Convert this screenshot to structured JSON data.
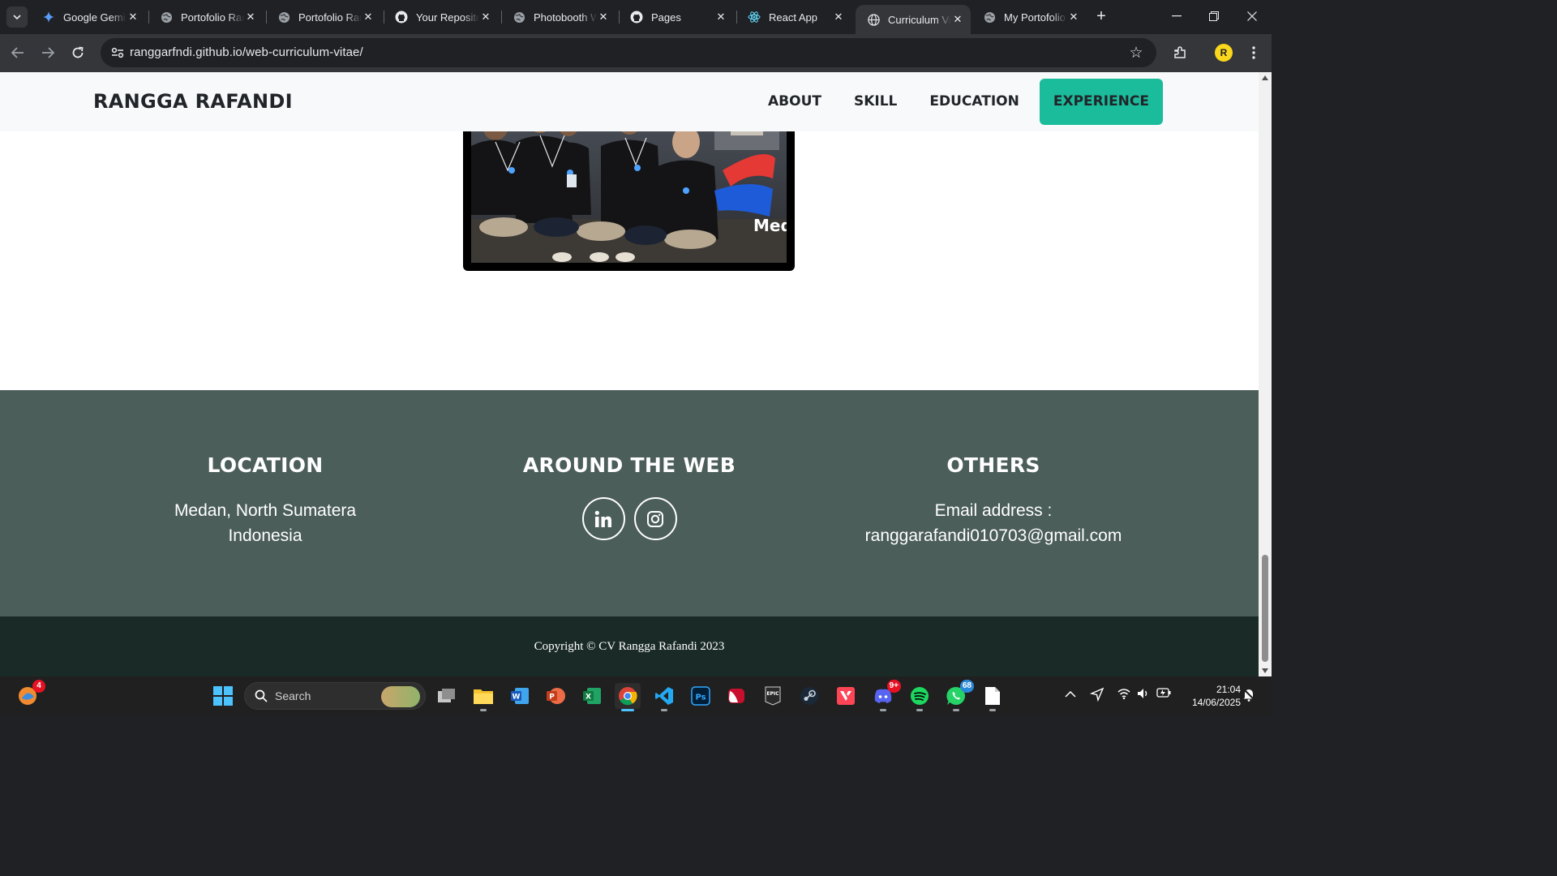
{
  "browser": {
    "tabs": [
      {
        "title": "Google Gemini",
        "icon": "gemini-icon"
      },
      {
        "title": "Portofolio Rangga",
        "icon": "globe-icon"
      },
      {
        "title": "Portofolio Rangga",
        "icon": "globe-icon"
      },
      {
        "title": "Your Repositories",
        "icon": "github-icon"
      },
      {
        "title": "Photobooth Web",
        "icon": "globe-icon"
      },
      {
        "title": "Pages",
        "icon": "github-icon"
      },
      {
        "title": "React App",
        "icon": "react-icon"
      },
      {
        "title": "Curriculum Vitae",
        "icon": "globe-icon",
        "active": true
      },
      {
        "title": "My Portofolio",
        "icon": "globe-icon"
      }
    ],
    "url": "ranggarfndi.github.io/web-curriculum-vitae/",
    "profile_initial": "R"
  },
  "site": {
    "brand": "RANGGA RAFANDI",
    "nav": [
      "ABOUT",
      "SKILL",
      "EDUCATION",
      "EXPERIENCE"
    ],
    "active_nav": "EXPERIENCE",
    "accent_color": "#1abc9c",
    "photo_overlay_text": "Med"
  },
  "footer": {
    "location": {
      "heading": "LOCATION",
      "line1": "Medan, North Sumatera",
      "line2": "Indonesia"
    },
    "web": {
      "heading": "AROUND THE WEB",
      "links": [
        "linkedin-icon",
        "instagram-icon"
      ]
    },
    "others": {
      "heading": "OTHERS",
      "line1": "Email address :",
      "line2": "ranggarafandi010703@gmail.com"
    },
    "copyright": "Copyright © CV Rangga Rafandi 2023",
    "bg_color": "#4b5e59",
    "copyright_bg": "#1a2b27"
  },
  "taskbar": {
    "search_label": "Search",
    "badges": {
      "browser_widget": "4",
      "discord": "9+",
      "whatsapp": "68"
    },
    "time": "21:04",
    "date": "14/06/2025"
  }
}
